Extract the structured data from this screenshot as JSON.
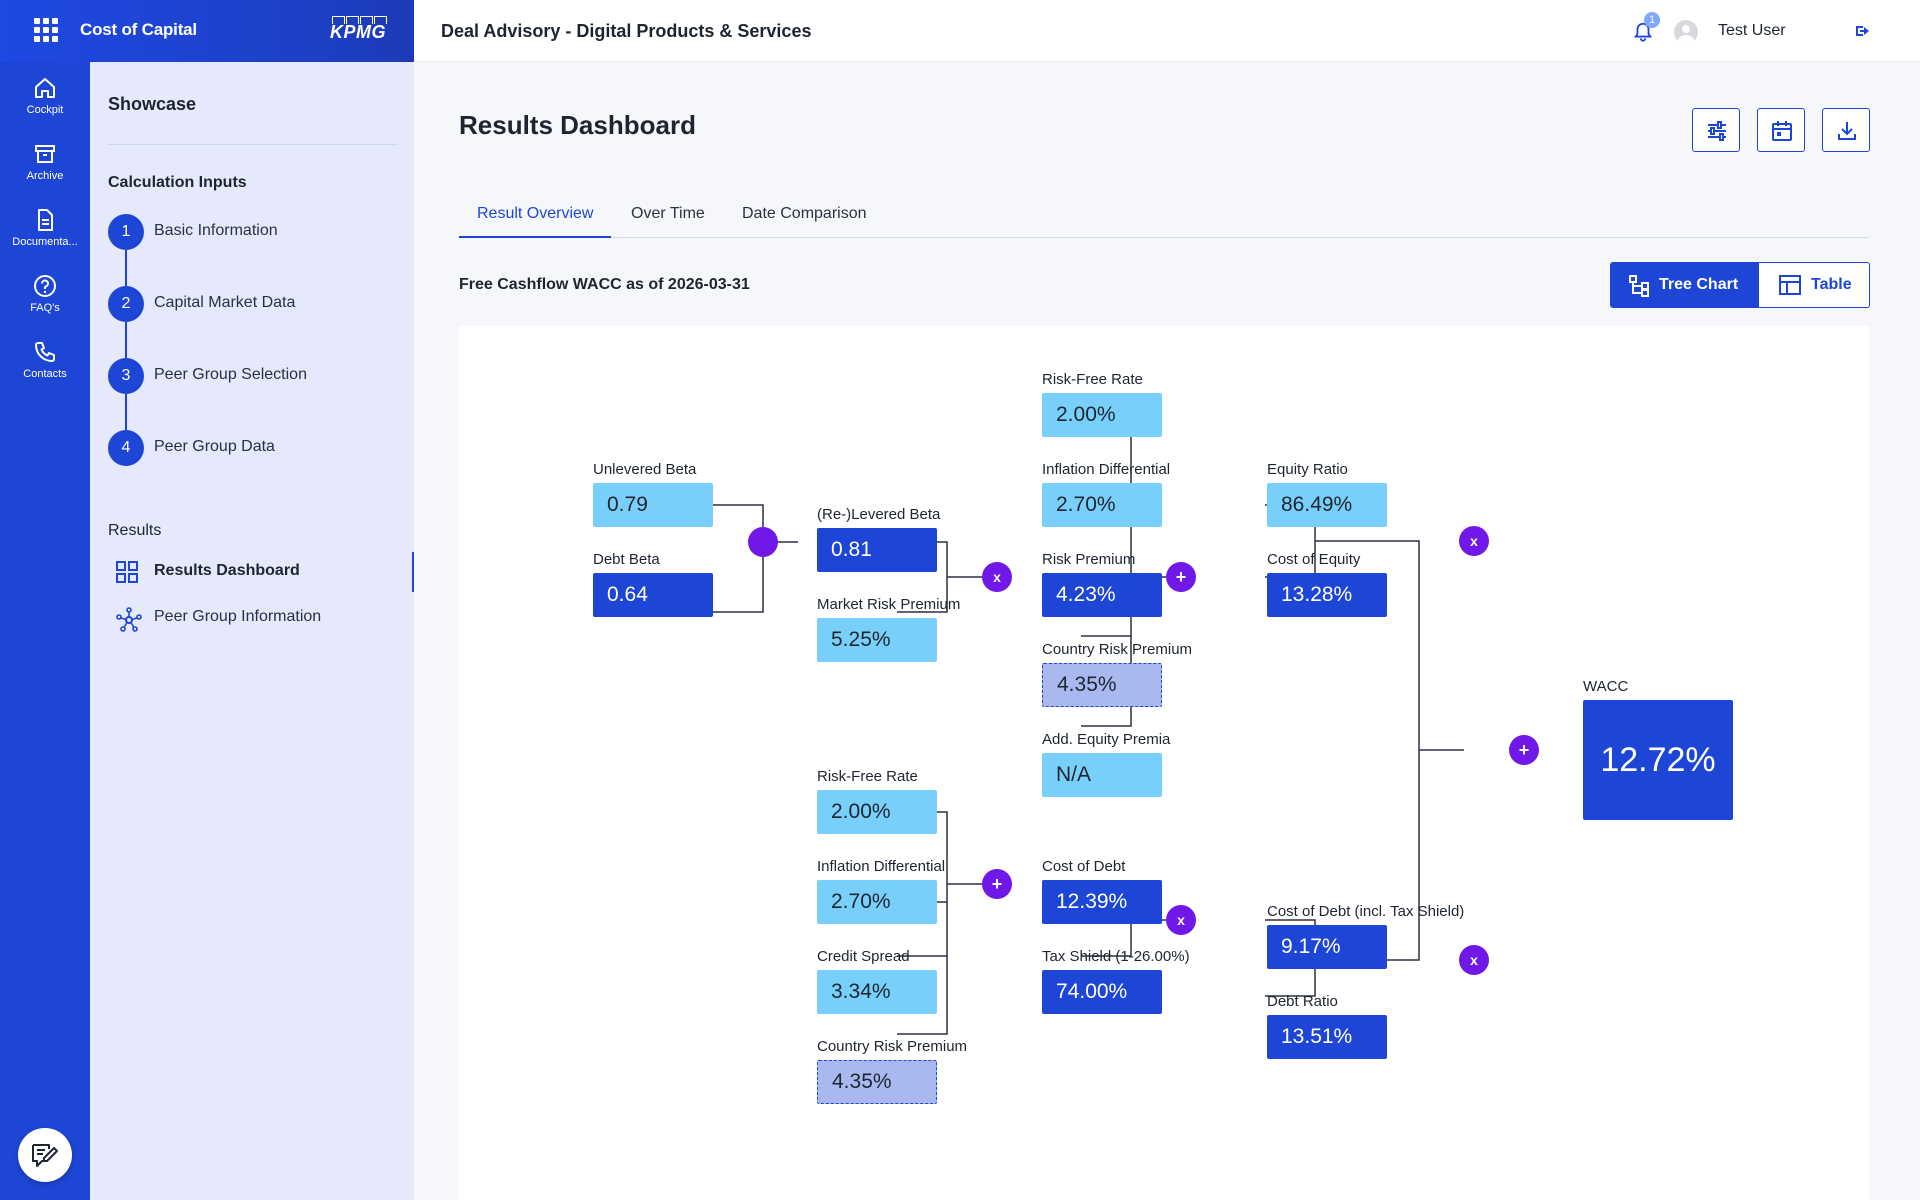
{
  "app": {
    "title": "Cost of Capital",
    "brand": "KPMG"
  },
  "header": {
    "title": "Deal Advisory - Digital Products & Services",
    "notifications": "1",
    "user_name": "Test User"
  },
  "rail": [
    {
      "label": "Cockpit",
      "icon": "home-icon"
    },
    {
      "label": "Archive",
      "icon": "archive-icon"
    },
    {
      "label": "Documenta...",
      "icon": "document-icon"
    },
    {
      "label": "FAQ's",
      "icon": "help-icon"
    },
    {
      "label": "Contacts",
      "icon": "phone-icon"
    }
  ],
  "sidenav": {
    "heading": "Showcase",
    "calc_heading": "Calculation Inputs",
    "steps": [
      {
        "num": "1",
        "label": "Basic Information"
      },
      {
        "num": "2",
        "label": "Capital Market Data"
      },
      {
        "num": "3",
        "label": "Peer Group Selection"
      },
      {
        "num": "4",
        "label": "Peer Group Data"
      }
    ],
    "results_heading": "Results",
    "results": [
      {
        "label": "Results Dashboard",
        "icon": "dashboard-grid-icon",
        "active": true
      },
      {
        "label": "Peer Group Information",
        "icon": "network-icon",
        "active": false
      }
    ]
  },
  "main": {
    "page_title": "Results Dashboard",
    "tabs": [
      "Result Overview",
      "Over Time",
      "Date Comparison"
    ],
    "active_tab": "Result Overview",
    "subtitle": "Free Cashflow WACC as of 2026-03-31",
    "view_toggle": {
      "tree": "Tree Chart",
      "table": "Table",
      "selected": "Tree Chart"
    }
  },
  "tree": {
    "unlevered_beta": {
      "label": "Unlevered Beta",
      "value": "0.79"
    },
    "debt_beta": {
      "label": "Debt Beta",
      "value": "0.64"
    },
    "relevered_beta": {
      "label": "(Re-)Levered Beta",
      "value": "0.81"
    },
    "market_risk_premium": {
      "label": "Market Risk Premium",
      "value": "5.25%"
    },
    "rf_equity": {
      "label": "Risk-Free Rate",
      "value": "2.00%"
    },
    "inflation_equity": {
      "label": "Inflation Differential",
      "value": "2.70%"
    },
    "risk_premium": {
      "label": "Risk Premium",
      "value": "4.23%"
    },
    "crp_equity": {
      "label": "Country Risk Premium",
      "value": "4.35%"
    },
    "add_equity_premia": {
      "label": "Add. Equity Premia",
      "value": "N/A"
    },
    "equity_ratio": {
      "label": "Equity Ratio",
      "value": "86.49%"
    },
    "cost_of_equity": {
      "label": "Cost of Equity",
      "value": "13.28%"
    },
    "wacc": {
      "label": "WACC",
      "value": "12.72%"
    },
    "rf_debt": {
      "label": "Risk-Free Rate",
      "value": "2.00%"
    },
    "inflation_debt": {
      "label": "Inflation Differential",
      "value": "2.70%"
    },
    "credit_spread": {
      "label": "Credit Spread",
      "value": "3.34%"
    },
    "crp_debt": {
      "label": "Country Risk Premium",
      "value": "4.35%"
    },
    "cost_of_debt": {
      "label": "Cost of Debt",
      "value": "12.39%"
    },
    "tax_shield": {
      "label": "Tax Shield (1-26.00%)",
      "value": "74.00%"
    },
    "cost_of_debt_ts": {
      "label": "Cost of Debt (incl. Tax Shield)",
      "value": "9.17%"
    },
    "debt_ratio": {
      "label": "Debt Ratio",
      "value": "13.51%"
    },
    "ops": {
      "multiply": "x",
      "add": "+"
    }
  }
}
